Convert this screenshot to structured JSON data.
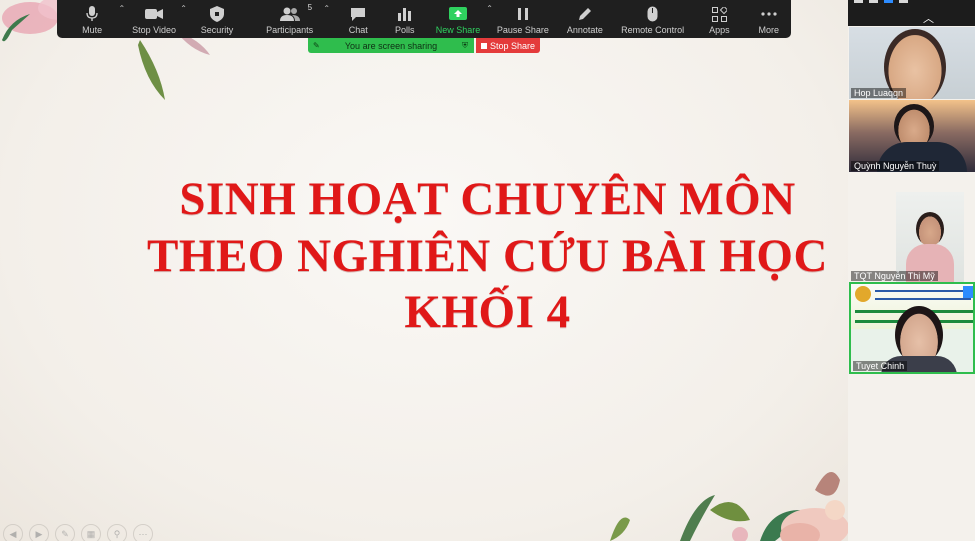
{
  "toolbar": {
    "items": [
      {
        "label": "Mute",
        "icon": "microphone-icon"
      },
      {
        "label": "Stop Video",
        "icon": "video-camera-icon"
      },
      {
        "label": "Security",
        "icon": "shield-icon"
      },
      {
        "label": "Participants",
        "icon": "people-icon",
        "count": "5"
      },
      {
        "label": "Chat",
        "icon": "chat-bubble-icon"
      },
      {
        "label": "Polls",
        "icon": "bar-chart-icon"
      },
      {
        "label": "New Share",
        "icon": "share-screen-icon"
      },
      {
        "label": "Pause Share",
        "icon": "pause-icon"
      },
      {
        "label": "Annotate",
        "icon": "pencil-icon"
      },
      {
        "label": "Remote Control",
        "icon": "mouse-icon"
      },
      {
        "label": "Apps",
        "icon": "apps-icon"
      },
      {
        "label": "More",
        "icon": "more-dots-icon"
      }
    ]
  },
  "share_banner": {
    "text": "You are screen sharing",
    "stop_label": "Stop Share"
  },
  "slide": {
    "line1": "SINH HOẠT CHUYÊN MÔN",
    "line2": "THEO NGHIÊN CỨU BÀI HỌC",
    "line3": "KHỐI 4"
  },
  "participants": [
    {
      "name": "Hop Luaqqn"
    },
    {
      "name": "Quỳnh Nguyễn Thuỳ"
    },
    {
      "name": "TQT Nguyễn Thị Mỹ"
    },
    {
      "name": "Tuyet Chinh"
    }
  ],
  "colors": {
    "title_red": "#e01818",
    "toolbar_bg": "#1f1f1f",
    "share_green": "#2fbd4d",
    "stop_red": "#e43b3b",
    "new_share_green": "#2fd15f"
  }
}
